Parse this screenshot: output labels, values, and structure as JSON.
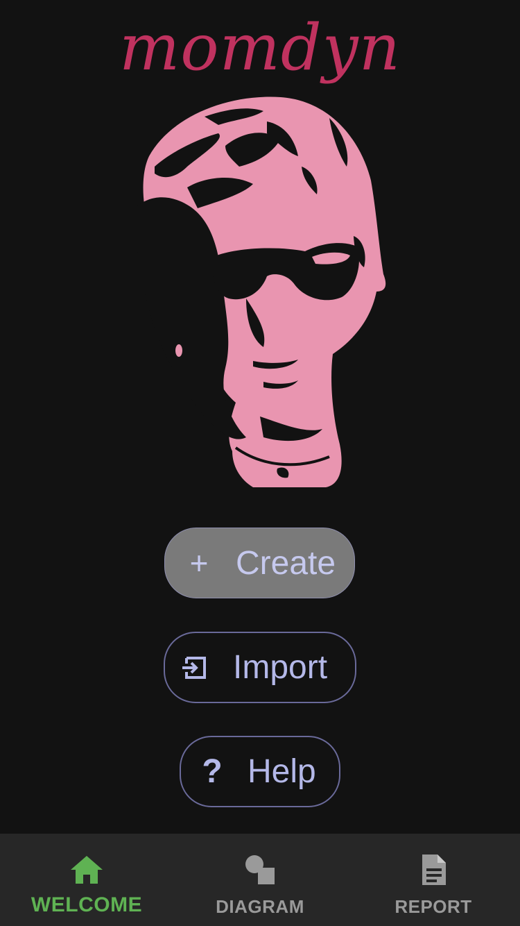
{
  "app": {
    "title": "momdyn"
  },
  "portrait": {
    "icon": "sunglasses-portrait-logo"
  },
  "buttons": {
    "create": {
      "icon": "plus-icon",
      "label": "Create"
    },
    "import": {
      "icon": "import-icon",
      "label": "Import"
    },
    "help": {
      "icon": "question-icon",
      "label": "Help"
    }
  },
  "bottom_nav": {
    "items": [
      {
        "label": "WELCOME",
        "icon": "home-icon",
        "active": true
      },
      {
        "label": "DIAGRAM",
        "icon": "shapes-icon",
        "active": false
      },
      {
        "label": "REPORT",
        "icon": "document-icon",
        "active": false
      }
    ]
  },
  "colors": {
    "background": "#121212",
    "title": "#c0325f",
    "portrait": "#e995b0",
    "button_text": "#b4b8e8",
    "create_bg": "#7a7a7a",
    "nav_bg": "#272727",
    "nav_active": "#5fb253",
    "nav_inactive": "#9a9a9a"
  }
}
